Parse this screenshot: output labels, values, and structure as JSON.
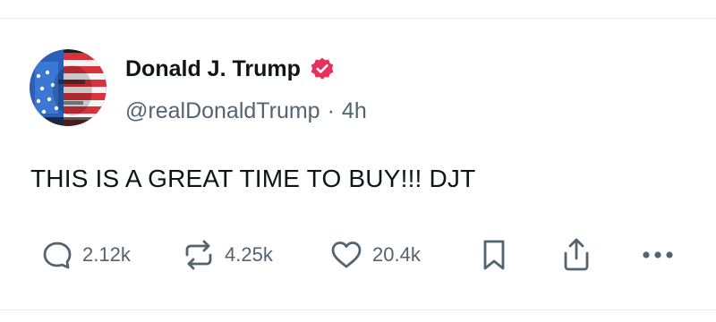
{
  "post": {
    "author": {
      "display_name": "Donald J. Trump",
      "handle": "@realDonaldTrump",
      "verified": true,
      "avatar_icon": "flag-portrait-avatar"
    },
    "separator": "·",
    "timestamp": "4h",
    "text": "THIS IS A GREAT TIME TO BUY!!! DJT",
    "actions": {
      "replies": "2.12k",
      "reposts": "4.25k",
      "likes": "20.4k",
      "bookmark_icon": "bookmark-icon",
      "share_icon": "share-icon",
      "more_icon": "more-icon"
    }
  },
  "colors": {
    "verified_badge": "#e8305a",
    "text_primary": "#0f1419",
    "text_secondary": "#536471",
    "divider": "#e6e6e6"
  }
}
